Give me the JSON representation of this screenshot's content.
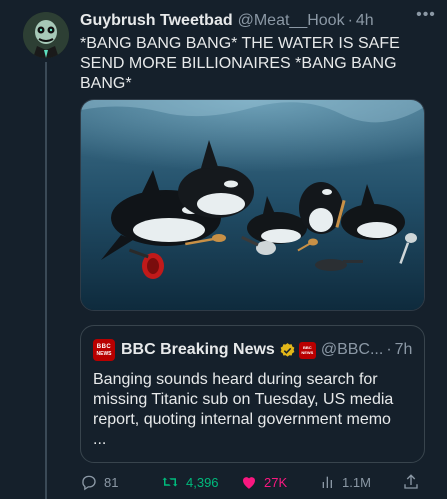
{
  "tweet": {
    "author_name": "Guybrush Tweetbad",
    "handle": "@Meat__Hook",
    "separator": "·",
    "time": "4h",
    "more_label": "•••",
    "text": "*BANG BANG BANG* THE WATER IS SAFE\nSEND MORE BILLIONAIRES *BANG BANG\nBANG*"
  },
  "quote": {
    "logo_top": "BBC",
    "logo_bottom": "NEWS",
    "name": "BBC Breaking News",
    "handle": "@BBC...",
    "separator": "·",
    "time": "7h",
    "text": "Banging sounds heard during search for\nmissing Titanic sub on Tuesday, US media\nreport, quoting internal government memo\n..."
  },
  "actions": {
    "replies": "81",
    "retweets": "4,396",
    "likes": "27K",
    "views": "1.1M"
  },
  "colors": {
    "background": "#15202b",
    "retweet_green": "#00ba7c",
    "like_pink": "#f91880",
    "bbc_red": "#b80000",
    "verified_gold": "#e2b719"
  },
  "icons": {
    "reply": "speech-bubble-icon",
    "retweet": "retweet-arrows-icon",
    "like": "heart-icon",
    "views": "bar-chart-icon",
    "share": "share-upload-icon"
  }
}
